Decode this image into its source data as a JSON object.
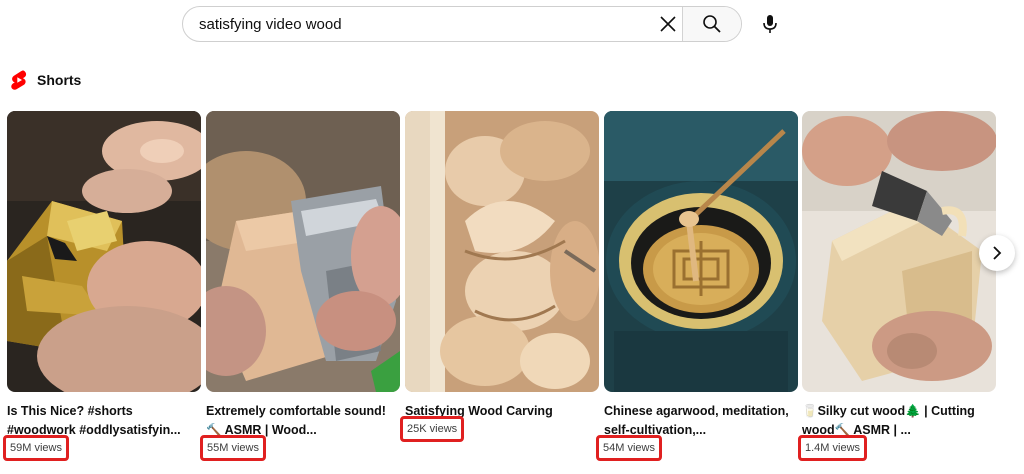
{
  "search": {
    "query": "satisfying video wood",
    "clear_icon": "close-icon",
    "search_icon": "search-icon",
    "mic_icon": "microphone-icon"
  },
  "shorts": {
    "title": "Shorts",
    "logo_icon": "youtube-shorts-logo",
    "logo_color": "#ff0000",
    "next_icon": "chevron-right-icon",
    "items": [
      {
        "title": "Is This Nice? #shorts #woodwork #oddlysatisfyin...",
        "views": "59M views"
      },
      {
        "title": "Extremely comfortable sound! 🔨 ASMR | Wood...",
        "views": "55M views"
      },
      {
        "title": "Satisfying Wood Carving",
        "views": "25K views"
      },
      {
        "title": "Chinese agarwood, meditation, self-cultivation,...",
        "views": "54M views"
      },
      {
        "title": "🥛Silky cut wood🌲 | Cutting wood🔨 ASMR | ...",
        "views": "1.4M views"
      }
    ]
  },
  "highlight_color": "#e02020"
}
